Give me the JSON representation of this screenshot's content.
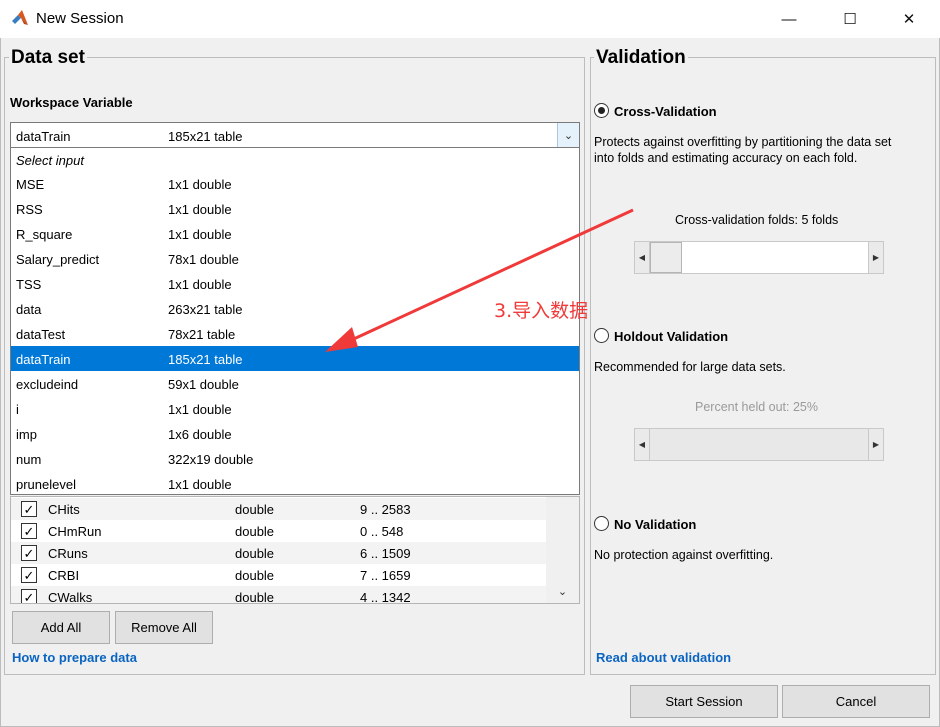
{
  "window": {
    "title": "New Session",
    "minimize": "—",
    "maximize": "☐",
    "close": "✕"
  },
  "dataset": {
    "title": "Data set",
    "workspace_label": "Workspace Variable",
    "selected": {
      "name": "dataTrain",
      "value": "185x21 table"
    },
    "dropdown_hint": "Select input",
    "options": [
      {
        "name": "MSE",
        "value": "1x1 double"
      },
      {
        "name": "RSS",
        "value": "1x1 double"
      },
      {
        "name": "R_square",
        "value": "1x1 double"
      },
      {
        "name": "Salary_predict",
        "value": "78x1 double"
      },
      {
        "name": "TSS",
        "value": "1x1 double"
      },
      {
        "name": "data",
        "value": "263x21 table"
      },
      {
        "name": "dataTest",
        "value": "78x21 table"
      },
      {
        "name": "dataTrain",
        "value": "185x21 table"
      },
      {
        "name": "excludeind",
        "value": "59x1 double"
      },
      {
        "name": "i",
        "value": "1x1 double"
      },
      {
        "name": "imp",
        "value": "1x6 double"
      },
      {
        "name": "num",
        "value": "322x19 double"
      },
      {
        "name": "prunelevel",
        "value": "1x1 double"
      }
    ],
    "rows": [
      {
        "name": "CHits",
        "type": "double",
        "range": "9 .. 2583"
      },
      {
        "name": "CHmRun",
        "type": "double",
        "range": "0 .. 548"
      },
      {
        "name": "CRuns",
        "type": "double",
        "range": "6 .. 1509"
      },
      {
        "name": "CRBI",
        "type": "double",
        "range": "7 .. 1659"
      },
      {
        "name": "CWalks",
        "type": "double",
        "range": "4 .. 1342"
      }
    ],
    "add_all": "Add All",
    "remove_all": "Remove All",
    "help_link": "How to prepare data"
  },
  "validation": {
    "title": "Validation",
    "cross": {
      "label": "Cross-Validation",
      "desc1": "Protects against overfitting by partitioning the data set",
      "desc2": "into folds and estimating accuracy on each fold.",
      "slider_label": "Cross-validation folds: 5 folds"
    },
    "holdout": {
      "label": "Holdout Validation",
      "desc": "Recommended for large data sets.",
      "slider_label": "Percent held out: 25%"
    },
    "none": {
      "label": "No Validation",
      "desc": "No protection against overfitting."
    },
    "help_link": "Read about validation"
  },
  "buttons": {
    "start": "Start Session",
    "cancel": "Cancel"
  },
  "annotation": {
    "text": "3.导入数据",
    "color": "#f03a3a"
  },
  "colors": {
    "selection": "#0078d7",
    "link": "#0a64c2"
  }
}
